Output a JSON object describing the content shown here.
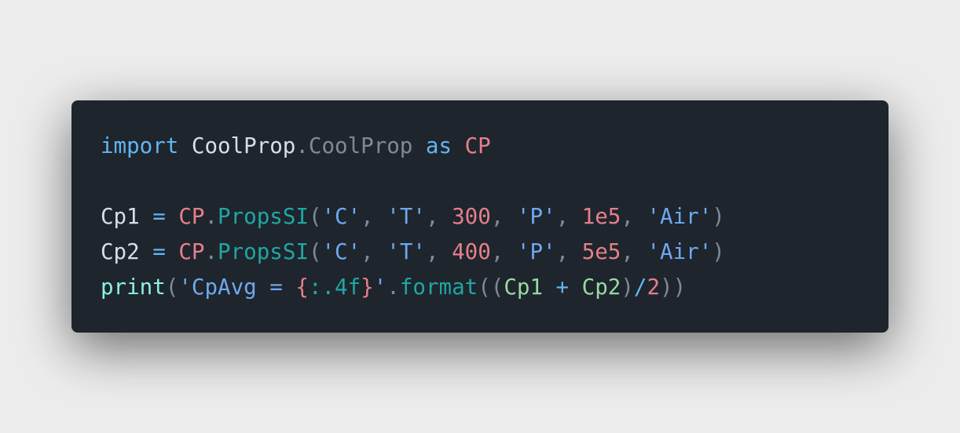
{
  "colors": {
    "background": "#ededed",
    "editor_background": "#1e252d",
    "keyword": "#62b6f0",
    "plain": "#d8dee6",
    "muted": "#7f8a96",
    "constant_red": "#e5808a",
    "method_teal": "#1fa7a3",
    "string_blue": "#6fa8f0",
    "variable_green": "#97d9a0",
    "builtin_cyan": "#8ef0e4"
  },
  "code_lines": [
    {
      "tokens": [
        {
          "text": "import",
          "color": "#62b6f0"
        },
        {
          "text": " CoolProp",
          "color": "#d8dee6"
        },
        {
          "text": ".CoolProp",
          "color": "#7f8a96"
        },
        {
          "text": " as",
          "color": "#62b6f0"
        },
        {
          "text": " CP",
          "color": "#e5808a"
        }
      ]
    },
    {
      "tokens": []
    },
    {
      "tokens": [
        {
          "text": "Cp1",
          "color": "#d8dee6"
        },
        {
          "text": " = ",
          "color": "#62b6f0"
        },
        {
          "text": "CP",
          "color": "#e5808a"
        },
        {
          "text": ".",
          "color": "#7f8a96"
        },
        {
          "text": "PropsSI",
          "color": "#1fa7a3"
        },
        {
          "text": "(",
          "color": "#7f8a96"
        },
        {
          "text": "'C'",
          "color": "#6fa8f0"
        },
        {
          "text": ", ",
          "color": "#7f8a96"
        },
        {
          "text": "'T'",
          "color": "#6fa8f0"
        },
        {
          "text": ", ",
          "color": "#7f8a96"
        },
        {
          "text": "300",
          "color": "#e5808a"
        },
        {
          "text": ", ",
          "color": "#7f8a96"
        },
        {
          "text": "'P'",
          "color": "#6fa8f0"
        },
        {
          "text": ", ",
          "color": "#7f8a96"
        },
        {
          "text": "1e5",
          "color": "#e5808a"
        },
        {
          "text": ", ",
          "color": "#7f8a96"
        },
        {
          "text": "'Air'",
          "color": "#6fa8f0"
        },
        {
          "text": ")",
          "color": "#7f8a96"
        }
      ]
    },
    {
      "tokens": [
        {
          "text": "Cp2",
          "color": "#d8dee6"
        },
        {
          "text": " = ",
          "color": "#62b6f0"
        },
        {
          "text": "CP",
          "color": "#e5808a"
        },
        {
          "text": ".",
          "color": "#7f8a96"
        },
        {
          "text": "PropsSI",
          "color": "#1fa7a3"
        },
        {
          "text": "(",
          "color": "#7f8a96"
        },
        {
          "text": "'C'",
          "color": "#6fa8f0"
        },
        {
          "text": ", ",
          "color": "#7f8a96"
        },
        {
          "text": "'T'",
          "color": "#6fa8f0"
        },
        {
          "text": ", ",
          "color": "#7f8a96"
        },
        {
          "text": "400",
          "color": "#e5808a"
        },
        {
          "text": ", ",
          "color": "#7f8a96"
        },
        {
          "text": "'P'",
          "color": "#6fa8f0"
        },
        {
          "text": ", ",
          "color": "#7f8a96"
        },
        {
          "text": "5e5",
          "color": "#e5808a"
        },
        {
          "text": ", ",
          "color": "#7f8a96"
        },
        {
          "text": "'Air'",
          "color": "#6fa8f0"
        },
        {
          "text": ")",
          "color": "#7f8a96"
        }
      ]
    },
    {
      "tokens": [
        {
          "text": "print",
          "color": "#8ef0e4"
        },
        {
          "text": "(",
          "color": "#7f8a96"
        },
        {
          "text": "'CpAvg = ",
          "color": "#6fa8f0"
        },
        {
          "text": "{",
          "color": "#e5808a"
        },
        {
          "text": ":.4f",
          "color": "#1fa7a3"
        },
        {
          "text": "}",
          "color": "#e5808a"
        },
        {
          "text": "'",
          "color": "#6fa8f0"
        },
        {
          "text": ".",
          "color": "#7f8a96"
        },
        {
          "text": "format",
          "color": "#1fa7a3"
        },
        {
          "text": "((",
          "color": "#7f8a96"
        },
        {
          "text": "Cp1",
          "color": "#97d9a0"
        },
        {
          "text": " + ",
          "color": "#62b6f0"
        },
        {
          "text": "Cp2",
          "color": "#97d9a0"
        },
        {
          "text": ")",
          "color": "#7f8a96"
        },
        {
          "text": "/",
          "color": "#62b6f0"
        },
        {
          "text": "2",
          "color": "#e5808a"
        },
        {
          "text": "))",
          "color": "#7f8a96"
        }
      ]
    }
  ]
}
